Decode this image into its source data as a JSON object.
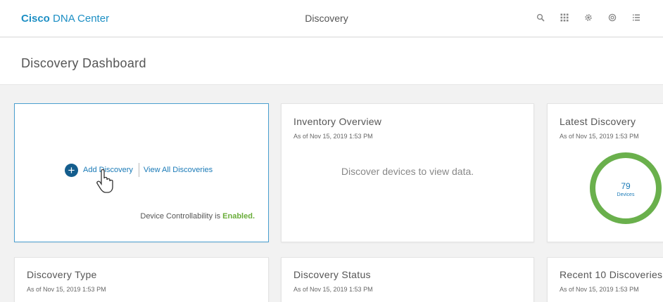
{
  "header": {
    "brand_bold": "Cisco",
    "brand_rest": "DNA Center",
    "title": "Discovery",
    "icons": [
      "search-icon",
      "apps-grid-icon",
      "gear-icon",
      "help-icon",
      "menu-list-icon"
    ]
  },
  "page": {
    "title": "Discovery Dashboard"
  },
  "cards": {
    "add": {
      "add_label": "Add Discovery",
      "view_all_label": "View All Discoveries",
      "controllability_prefix": "Device Controllability is",
      "controllability_status": "Enabled."
    },
    "inventory": {
      "title": "Inventory Overview",
      "subtitle": "As of Nov 15, 2019 1:53 PM",
      "empty": "Discover devices to view data."
    },
    "latest": {
      "title": "Latest Discovery",
      "subtitle": "As of Nov 15, 2019 1:53 PM",
      "value": "79",
      "value_label": "Devices"
    },
    "type": {
      "title": "Discovery Type",
      "subtitle": "As of Nov 15, 2019 1:53 PM"
    },
    "status": {
      "title": "Discovery Status",
      "subtitle": "As of Nov 15, 2019 1:53 PM"
    },
    "recent": {
      "title": "Recent 10 Discoveries",
      "subtitle": "As of Nov 15, 2019 1:53 PM"
    }
  },
  "colors": {
    "brand": "#1d8fc4",
    "link": "#1a7ab7",
    "enabled": "#6aad3a",
    "donut": "#6ab04c",
    "add_button": "#145d8d"
  }
}
